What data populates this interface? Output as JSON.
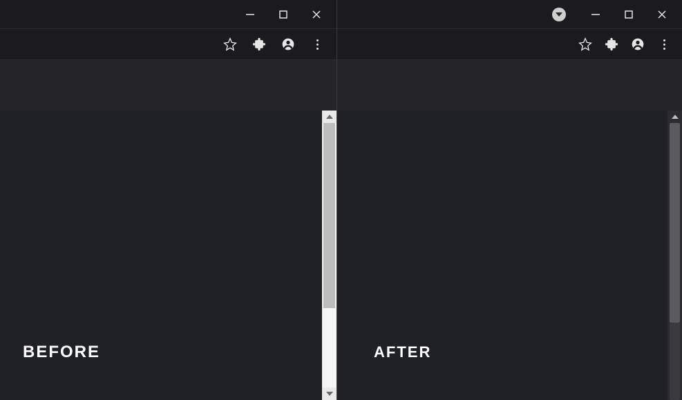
{
  "left": {
    "label": "BEFORE",
    "window": {
      "minimize": "Minimize",
      "maximize": "Maximize",
      "close": "Close"
    },
    "toolbar": {
      "bookmark": "Bookmark this page",
      "extensions": "Extensions",
      "profile": "Profile",
      "menu": "Menu"
    },
    "scrollbar": {
      "thumb_fraction": 0.7,
      "orientation": "vertical",
      "style": "light"
    }
  },
  "right": {
    "label": "AFTER",
    "dropdown_name": "dark-scrollbar-dropdown-icon",
    "window": {
      "minimize": "Minimize",
      "maximize": "Maximize",
      "close": "Close"
    },
    "toolbar": {
      "bookmark": "Bookmark this page",
      "extensions": "Extensions",
      "profile": "Profile",
      "menu": "Menu"
    },
    "scrollbar": {
      "thumb_fraction": 0.72,
      "orientation": "vertical",
      "style": "dark"
    }
  },
  "colors": {
    "bg": "#1b1b1f",
    "content": "#1f2126",
    "strip": "#242429",
    "text": "#ffffff",
    "icon": "#e8e6e3"
  }
}
